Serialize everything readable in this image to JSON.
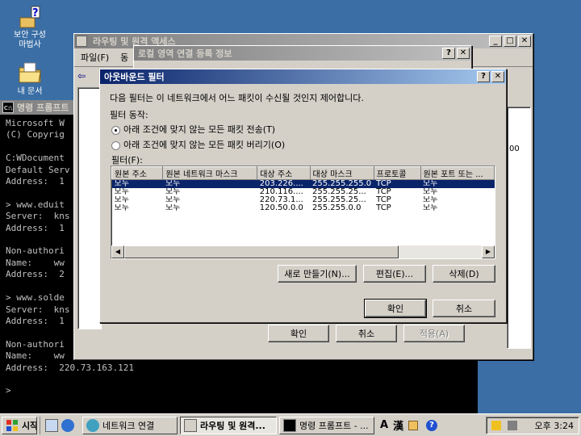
{
  "desktop": {
    "icons": [
      {
        "label_line1": "보안 구성",
        "label_line2": "마법사"
      },
      {
        "label_line1": "내 문서",
        "label_line2": ""
      }
    ]
  },
  "cmd": {
    "title": "명령 프롬프트",
    "lines": [
      "Microsoft W",
      "(C) Copyrig",
      "",
      "C:WDocument",
      "Default Serv",
      "Address:  1",
      "",
      "> www.eduit",
      "Server:  kns",
      "Address:  1",
      "",
      "Non-authori",
      "Name:    ww",
      "Address:  2",
      "",
      "> www.solde",
      "Server:  kns",
      "Address:  1",
      "",
      "Non-authori",
      "Name:    ww",
      "Address:  220.73.163.121",
      "",
      ">"
    ]
  },
  "rras": {
    "title": "라우팅 및 원격 액세스",
    "menu": [
      "파일(F)",
      "동"
    ],
    "buttons": {
      "ok": "확인",
      "cancel": "취소",
      "apply": "적용(A)"
    },
    "right_text": "00"
  },
  "local_conn": {
    "title": "로컬 영역 연결 등록 정보"
  },
  "outbound": {
    "title": "아웃바운드 필터",
    "description": "다음 필터는 이 네트워크에서 어느 패킷이 수신될 것인지 제어합니다.",
    "action_label": "필터 동작:",
    "option_send": "아래 조건에 맞지 않는 모든 패킷 전송(T)",
    "option_drop": "아래 조건에 맞지 않는 모든 패킷 버리기(O)",
    "filters_label": "필터(F):",
    "columns": [
      "원본 주소",
      "원본 네트워크 마스크",
      "대상 주소",
      "대상 마스크",
      "프로토콜",
      "원본 포트 또는 ..."
    ],
    "rows": [
      [
        "모두",
        "모두",
        "203.226....",
        "255.255.255.0",
        "TCP",
        "모두"
      ],
      [
        "모두",
        "모두",
        "210.116....",
        "255.255.25...",
        "TCP",
        "모두"
      ],
      [
        "모두",
        "모두",
        "220.73.1...",
        "255.255.25...",
        "TCP",
        "모두"
      ],
      [
        "모두",
        "모두",
        "120.50.0.0",
        "255.255.0.0",
        "TCP",
        "모두"
      ]
    ],
    "selected_row": 0,
    "buttons": {
      "new": "새로 만들기(N)...",
      "edit": "편집(E)...",
      "delete": "삭제(D)",
      "ok": "확인",
      "cancel": "취소"
    }
  },
  "taskbar": {
    "start": "시작",
    "items": [
      "네트워크 연결",
      "라우팅 및 원격...",
      "명령 프롬프트 - ..."
    ],
    "ime": [
      "A",
      "漢"
    ],
    "clock": "오후 3:24"
  },
  "colors": {
    "desktop": "#3a6ea5",
    "title_active": "#0a246a",
    "face": "#d4d0c8"
  }
}
